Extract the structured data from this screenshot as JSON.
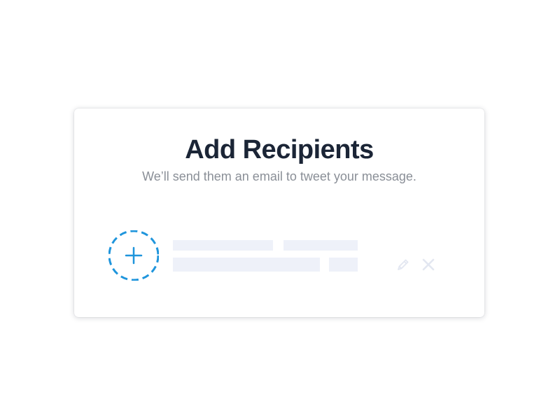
{
  "dialog": {
    "title": "Add Recipients",
    "subtitle": "We’ll send them an email to tweet your message."
  },
  "recipient_row": {
    "add_button_icon": "plus-icon",
    "edit_icon": "pencil-icon",
    "remove_icon": "close-icon",
    "state": "empty-placeholder"
  },
  "colors": {
    "accent": "#1f95dc",
    "title": "#1b2536",
    "subtitle": "#8a8f97",
    "placeholder": "#eef1f9",
    "muted_icon": "#e3e7f1"
  }
}
